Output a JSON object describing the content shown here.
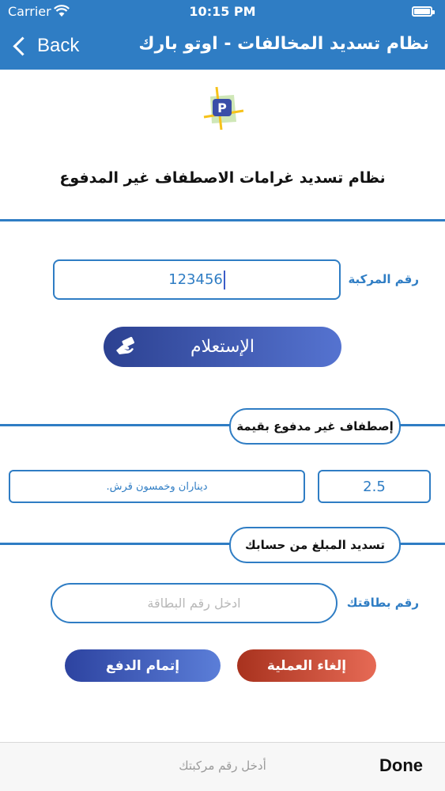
{
  "status_bar": {
    "carrier": "Carrier",
    "time": "10:15 PM"
  },
  "nav": {
    "back_label": "Back",
    "title": "نظام تسديد المخالفات - اوتو بارك"
  },
  "logo": {
    "letter": "P"
  },
  "main_title": "نظام تسديد غرامات الاصطفاف غير المدفوع",
  "vehicle": {
    "label": "رقم المركبة",
    "value": "123456"
  },
  "inquiry_button": {
    "label": "الإستعلام"
  },
  "unpaid_section": {
    "label": "إصطفاف غير مدفوع بقيمة"
  },
  "amount": {
    "value": "2.5",
    "text": "ديناران وخمسون قرش."
  },
  "payment_section": {
    "label": "تسديد المبلغ من حسابك"
  },
  "card": {
    "label": "رقم بطاقتك",
    "placeholder": "ادخل رقم البطاقة"
  },
  "buttons": {
    "cancel": "إلغاء العملية",
    "complete": "إتمام الدفع"
  },
  "keyboard_bar": {
    "placeholder": "أدخل رقم مركبتك",
    "done": "Done"
  },
  "colors": {
    "primary": "#2f7dc4",
    "inquiry_gradient": [
      "#2c4191",
      "#5573d0"
    ],
    "cancel_gradient": [
      "#a8321e",
      "#e66a55"
    ],
    "complete_gradient": [
      "#2d43a0",
      "#5b7ed8"
    ]
  }
}
